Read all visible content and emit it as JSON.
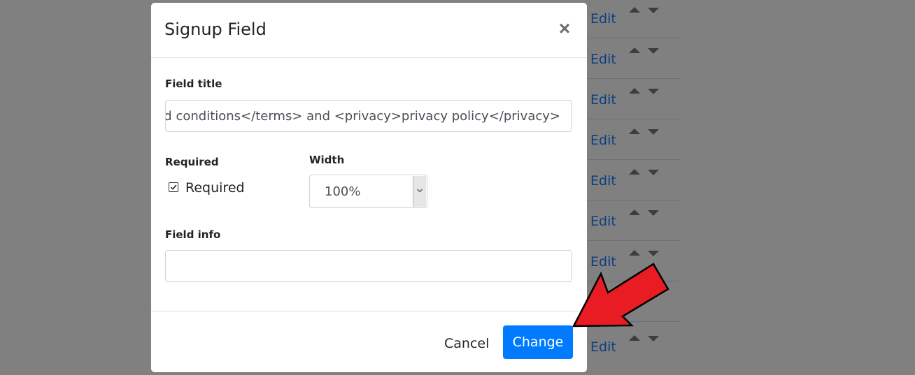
{
  "background_list": {
    "edit_label": "Edit",
    "row_count": 9
  },
  "modal": {
    "title": "Signup Field",
    "close_icon": "close-icon",
    "field_title": {
      "label": "Field title",
      "value": "d conditions</terms> and <privacy>privacy policy</privacy>"
    },
    "required": {
      "label": "Required",
      "checkbox_label": "Required",
      "checked": true
    },
    "width": {
      "label": "Width",
      "selected": "100%"
    },
    "field_info": {
      "label": "Field info",
      "value": ""
    },
    "footer": {
      "cancel_label": "Cancel",
      "change_label": "Change"
    }
  },
  "colors": {
    "overlay": "#808080",
    "primary_button": "#007bff",
    "annotation_arrow": "#e81c22"
  },
  "annotation": {
    "icon": "red-arrow-icon"
  }
}
